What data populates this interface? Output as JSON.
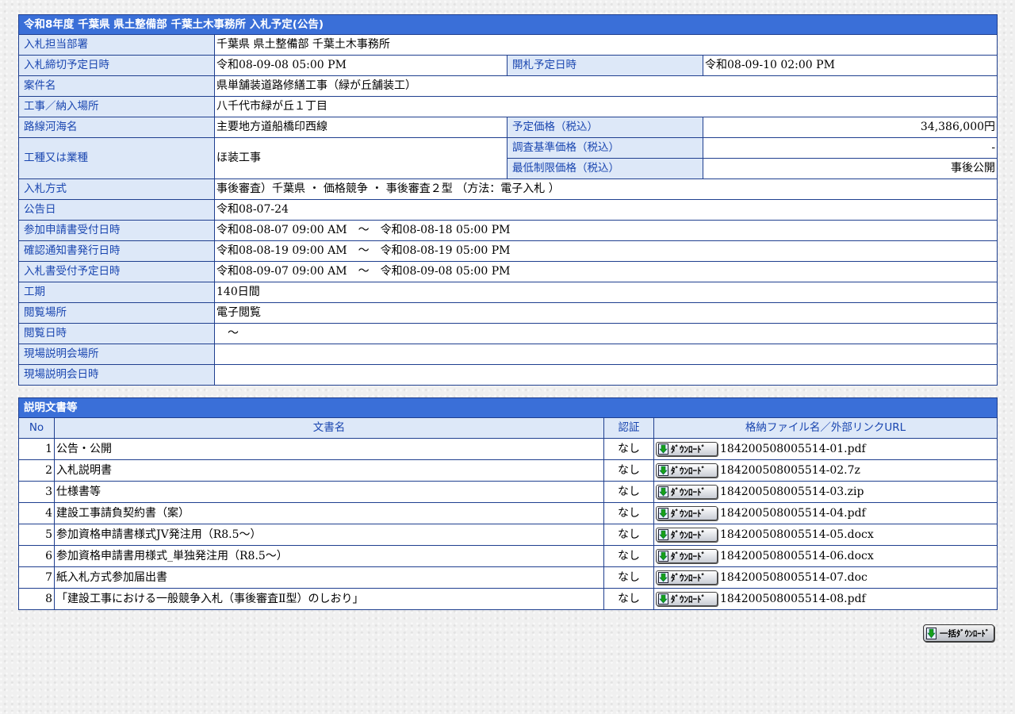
{
  "main": {
    "title": "令和8年度 千葉県 県土整備部 千葉土木事務所 入札予定(公告)",
    "labels": {
      "dept": "入札担当部署",
      "deadline": "入札締切予定日時",
      "opening": "開札予定日時",
      "case": "案件名",
      "place": "工事／納入場所",
      "route": "路線河海名",
      "planned_price": "予定価格（税込）",
      "type": "工種又は業種",
      "survey_price": "調査基準価格（税込）",
      "min_price": "最低制限価格（税込）",
      "method": "入札方式",
      "notice": "公告日",
      "application": "参加申請書受付日時",
      "confirmation": "確認通知書発行日時",
      "bid_receipt": "入札書受付予定日時",
      "period": "工期",
      "view_place": "閲覧場所",
      "view_time": "閲覧日時",
      "site_place": "現場説明会場所",
      "site_time": "現場説明会日時"
    },
    "values": {
      "dept": "千葉県 県土整備部 千葉土木事務所",
      "deadline": "令和08-09-08 05:00 PM",
      "opening": "令和08-09-10 02:00 PM",
      "case": "県単舗装道路修繕工事（緑が丘舗装工）",
      "place": "八千代市緑が丘１丁目",
      "route": "主要地方道船橋印西線",
      "planned_price": "34,386,000円",
      "type": "ほ装工事",
      "survey_price": "-",
      "min_price": "事後公開",
      "method": "事後審査）千葉県 ・ 価格競争 ・ 事後審査２型 （方法：電子入札 ）",
      "notice": "令和08-07-24",
      "application": "令和08-08-07 09:00 AM　～　令和08-08-18 05:00 PM",
      "confirmation": "令和08-08-19 09:00 AM　～　令和08-08-19 05:00 PM",
      "bid_receipt": "令和08-09-07 09:00 AM　～　令和08-09-08 05:00 PM",
      "period": "140日間",
      "view_place": "電子閲覧",
      "view_time": "　～",
      "site_place": "",
      "site_time": ""
    }
  },
  "docs": {
    "title": "説明文書等",
    "headers": {
      "no": "No",
      "name": "文書名",
      "auth": "認証",
      "file": "格納ファイル名／外部リンクURL"
    },
    "download_label": "ﾀﾞｳﾝﾛｰﾄﾞ",
    "rows": [
      {
        "no": "1",
        "name": "公告・公開",
        "auth": "なし",
        "file": "184200508005514-01.pdf"
      },
      {
        "no": "2",
        "name": "入札説明書",
        "auth": "なし",
        "file": "184200508005514-02.7z"
      },
      {
        "no": "3",
        "name": "仕様書等",
        "auth": "なし",
        "file": "184200508005514-03.zip"
      },
      {
        "no": "4",
        "name": "建設工事請負契約書（案）",
        "auth": "なし",
        "file": "184200508005514-04.pdf"
      },
      {
        "no": "5",
        "name": "参加資格申請書様式JV発注用（R8.5～）",
        "auth": "なし",
        "file": "184200508005514-05.docx"
      },
      {
        "no": "6",
        "name": "参加資格申請書用様式_単独発注用（R8.5～）",
        "auth": "なし",
        "file": "184200508005514-06.docx"
      },
      {
        "no": "7",
        "name": "紙入札方式参加届出書",
        "auth": "なし",
        "file": "184200508005514-07.doc"
      },
      {
        "no": "8",
        "name": "「建設工事における一般競争入札（事後審査Ⅱ型）のしおり」",
        "auth": "なし",
        "file": "184200508005514-08.pdf"
      }
    ],
    "bulk_label": "一括ﾀﾞｳﾝﾛｰﾄﾞ"
  }
}
